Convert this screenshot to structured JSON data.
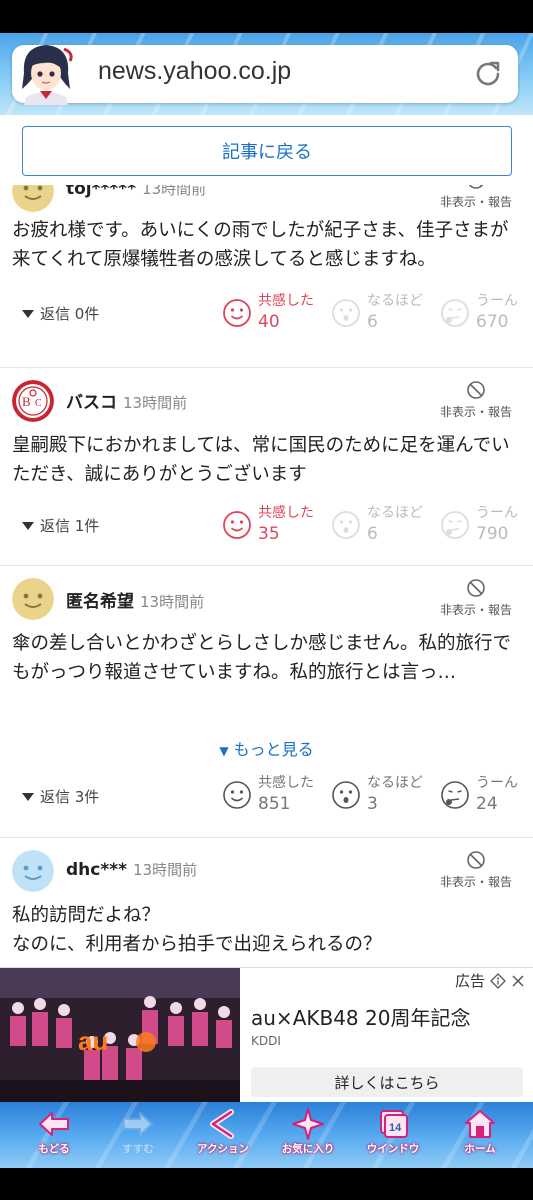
{
  "browser": {
    "url": "news.yahoo.co.jp",
    "back_to_article": "記事に戻る"
  },
  "colors": {
    "accent": "#1a6fc7",
    "reaction_active": "#e0455a"
  },
  "comments": [
    {
      "user": "toj*****",
      "time": "13時間前",
      "hide_label": "非表示・報告",
      "body": "お疲れ様です。あいにくの雨でしたが紀子さま、佳子さまが来てくれて原爆犠牲者の感涙してると感じますね。",
      "reply": "返信 0件",
      "reactions": [
        {
          "label": "共感した",
          "count": "40"
        },
        {
          "label": "なるほど",
          "count": "6"
        },
        {
          "label": "うーん",
          "count": "670"
        }
      ]
    },
    {
      "user": "バスコ",
      "time": "13時間前",
      "hide_label": "非表示・報告",
      "body": "皇嗣殿下におかれましては、常に国民のために足を運んでいただき、誠にありがとうございます",
      "reply": "返信 1件",
      "reactions": [
        {
          "label": "共感した",
          "count": "35"
        },
        {
          "label": "なるほど",
          "count": "6"
        },
        {
          "label": "うーん",
          "count": "790"
        }
      ]
    },
    {
      "user": "匿名希望",
      "time": "13時間前",
      "hide_label": "非表示・報告",
      "body": "傘の差し合いとかわざとらしさしか感じません。私的旅行でもがっつり報道させていますね。私的旅行とは言っ…",
      "more": "もっと見る",
      "reply": "返信 3件",
      "reactions": [
        {
          "label": "共感した",
          "count": "851"
        },
        {
          "label": "なるほど",
          "count": "3"
        },
        {
          "label": "うーん",
          "count": "24"
        }
      ]
    },
    {
      "user": "dhc***",
      "time": "13時間前",
      "hide_label": "非表示・報告",
      "body_line1": "私的訪問だよね？",
      "body_line2": "なのに、利用者から拍手で出迎えられるの？"
    }
  ],
  "ad": {
    "label": "広告",
    "title": "au×AKB48 20周年記念",
    "sponsor": "KDDI",
    "cta": "詳しくはこちら",
    "image_logo": "au"
  },
  "toolbar": {
    "back": "もどる",
    "forward": "すすむ",
    "action": "アクション",
    "bookmark": "お気に入り",
    "window": "ウインドウ",
    "window_count": "14",
    "home": "ホーム"
  }
}
